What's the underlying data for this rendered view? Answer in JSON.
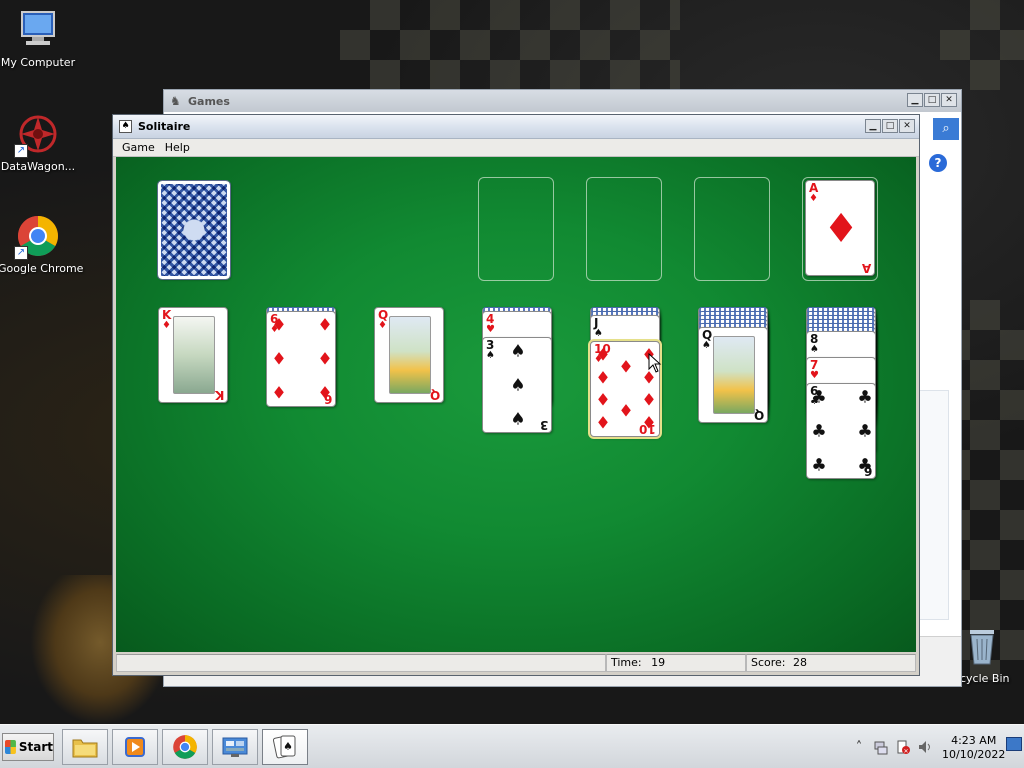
{
  "desktop": {
    "icons": [
      {
        "label": "My Computer",
        "icon": "computer-icon"
      },
      {
        "label": "DataWagon...",
        "icon": "datawagon-icon"
      },
      {
        "label": "Google Chrome",
        "icon": "chrome-icon"
      },
      {
        "label": "cycle Bin",
        "icon": "recycle-bin-icon"
      }
    ]
  },
  "games_window": {
    "title": "Games"
  },
  "solitaire": {
    "title": "Solitaire",
    "menu": [
      "Game",
      "Help"
    ],
    "status": {
      "time_label": "Time:",
      "time_value": "19",
      "score_label": "Score:",
      "score_value": "28"
    },
    "foundation": [
      {
        "rank": "",
        "suit": ""
      },
      {
        "rank": "",
        "suit": ""
      },
      {
        "rank": "",
        "suit": ""
      },
      {
        "rank": "A",
        "suit": "♦"
      }
    ],
    "tableau": [
      {
        "hidden": 0,
        "cards": [
          {
            "rank": "K",
            "suit": "♦",
            "color": "red"
          }
        ]
      },
      {
        "hidden": 1,
        "cards": [
          {
            "rank": "6",
            "suit": "♦",
            "color": "red"
          }
        ]
      },
      {
        "hidden": 0,
        "cards": [
          {
            "rank": "Q",
            "suit": "♦",
            "color": "red"
          }
        ]
      },
      {
        "hidden": 1,
        "cards": [
          {
            "rank": "4",
            "suit": "♥",
            "color": "red"
          },
          {
            "rank": "3",
            "suit": "♠",
            "color": "black"
          }
        ]
      },
      {
        "hidden": 2,
        "cards": [
          {
            "rank": "J",
            "suit": "♠",
            "color": "black"
          },
          {
            "rank": "10",
            "suit": "♦",
            "color": "red"
          }
        ]
      },
      {
        "hidden": 5,
        "cards": [
          {
            "rank": "Q",
            "suit": "♠",
            "color": "black"
          }
        ]
      },
      {
        "hidden": 6,
        "cards": [
          {
            "rank": "8",
            "suit": "♠",
            "color": "black"
          },
          {
            "rank": "7",
            "suit": "♥",
            "color": "red"
          },
          {
            "rank": "6",
            "suit": "♣",
            "color": "black"
          }
        ]
      }
    ]
  },
  "taskbar": {
    "start_label": "Start",
    "apps": [
      "file-explorer-icon",
      "media-player-icon",
      "chrome-icon",
      "control-panel-icon",
      "solitaire-icon"
    ],
    "clock_time": "4:23 AM",
    "clock_date": "10/10/2022",
    "tray_icons": [
      "show-hidden-icons-chevron",
      "network-icon",
      "action-center-icon",
      "volume-icon"
    ]
  },
  "colors": {
    "felt": "#118a32",
    "card_red": "#e2141b",
    "card_black": "#111111"
  }
}
